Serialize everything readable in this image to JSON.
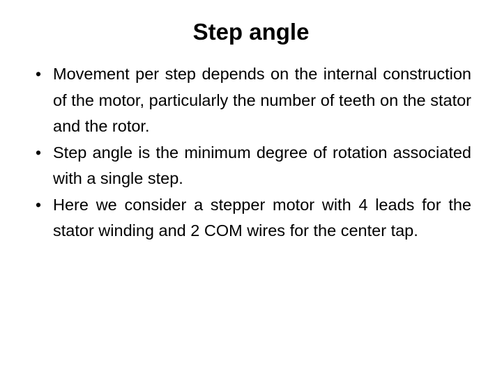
{
  "slide": {
    "title": "Step angle",
    "bullet_glyph": "•",
    "bullets": [
      "Movement per step depends on the internal construction of the motor, particularly the number of teeth on the stator and the rotor.",
      "Step angle is the minimum degree of rotation associated with a single step.",
      "Here we consider a stepper motor  with 4 leads for the stator winding and 2 COM wires for the center tap."
    ]
  }
}
